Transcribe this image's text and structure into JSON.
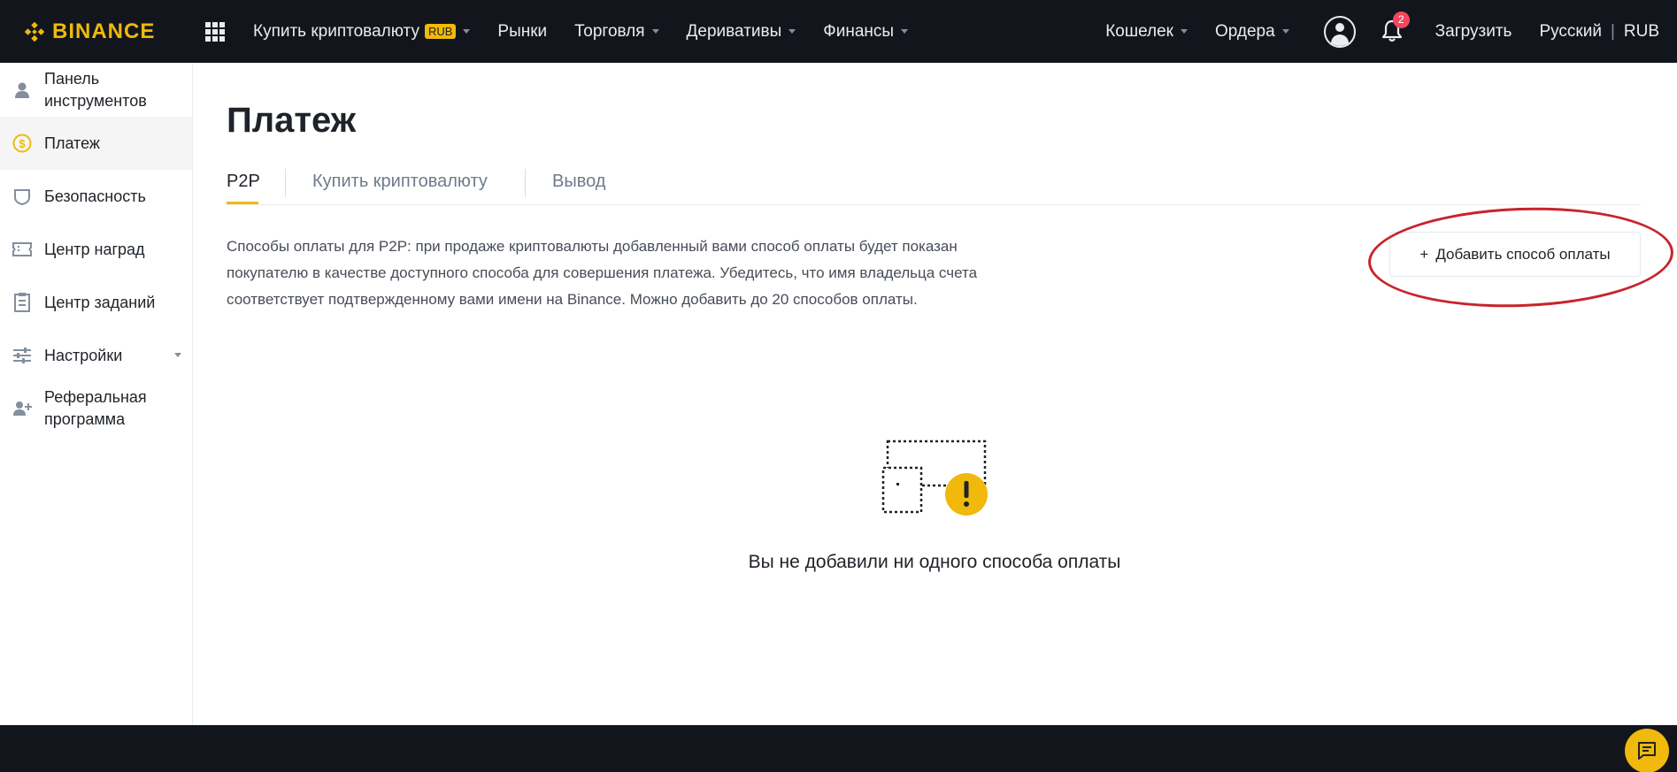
{
  "brand": {
    "name": "BINANCE",
    "accent": "#f0b90b"
  },
  "nav": {
    "buy_crypto": "Купить криптовалюту",
    "buy_crypto_badge": "RUB",
    "markets": "Рынки",
    "trade": "Торговля",
    "derivatives": "Деривативы",
    "finance": "Финансы",
    "wallet": "Кошелек",
    "orders": "Ордера",
    "notifications_count": "2",
    "download": "Загрузить",
    "language": "Русский",
    "separator": "|",
    "currency": "RUB"
  },
  "sidebar": {
    "items": [
      {
        "label": "Панель инструментов",
        "icon": "user-icon"
      },
      {
        "label": "Платеж",
        "icon": "dollar-coin-icon",
        "active": true
      },
      {
        "label": "Безопасность",
        "icon": "shield-icon"
      },
      {
        "label": "Центр наград",
        "icon": "ticket-icon"
      },
      {
        "label": "Центр заданий",
        "icon": "clipboard-icon"
      },
      {
        "label": "Настройки",
        "icon": "sliders-icon",
        "has_dropdown": true
      },
      {
        "label": "Реферальная программа",
        "icon": "add-user-icon"
      }
    ]
  },
  "main": {
    "title": "Платеж",
    "tabs": [
      {
        "label": "P2P",
        "active": true
      },
      {
        "label": "Купить криптовалюту"
      },
      {
        "label": "Вывод"
      }
    ],
    "description": "Способы оплаты для P2P: при продаже криптовалюты добавленный вами способ оплаты будет показан покупателю в качестве доступного способа для совершения платежа. Убедитесь, что имя владельца счета соответствует подтвержденному вами имени на Binance. Можно добавить до 20 способов оплаты.",
    "add_button": {
      "plus": "+",
      "label": "Добавить способ оплаты"
    },
    "empty_state": {
      "icon": "empty-payment-warning-icon",
      "text": "Вы не добавили ни одного способа оплаты"
    }
  },
  "colors": {
    "topbar_bg": "#12161c",
    "highlight_oval": "#c8232c",
    "notification_badge": "#f6465d"
  }
}
